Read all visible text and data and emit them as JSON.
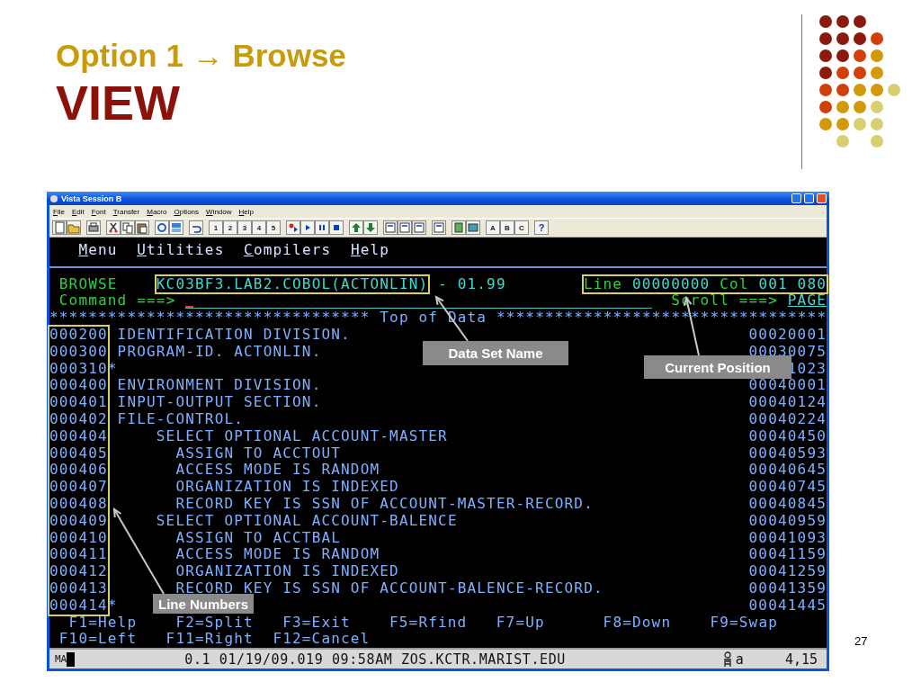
{
  "slide": {
    "title": "Option 1 → Browse",
    "subtitle": "VIEW",
    "page_number": "27"
  },
  "window": {
    "title": "Vista Session B",
    "menu": [
      "File",
      "Edit",
      "Font",
      "Transfer",
      "Macro",
      "Options",
      "Window",
      "Help"
    ],
    "macro_buttons": [
      "1",
      "2",
      "3",
      "4",
      "5"
    ],
    "keypad_buttons": [
      "A",
      "B",
      "C"
    ],
    "help_button": "?"
  },
  "terminal": {
    "action_bar": [
      "Menu",
      "Utilities",
      "Compilers",
      "Help"
    ],
    "header": {
      "mode": "BROWSE",
      "dataset": "KC03BF3.LAB2.COBOL(ACTONLIN)",
      "member_info": "- 01.99",
      "line_label": "Line",
      "line_value": "00000000",
      "col_label": "Col",
      "col_value": "001 080"
    },
    "command": {
      "label": "Command ===>"
    },
    "scroll": {
      "label": "Scroll ===>",
      "value": "PAGE"
    },
    "top_of_data": "********************************* Top of Data **********************************",
    "rows": [
      {
        "number": "000200",
        "text": " IDENTIFICATION DIVISION.",
        "sequence": "00020001"
      },
      {
        "number": "000300",
        "text": " PROGRAM-ID. ACTONLIN.",
        "sequence": "00030075"
      },
      {
        "number": "000310",
        "text": "*",
        "sequence": "1023"
      },
      {
        "number": "000400",
        "text": " ENVIRONMENT DIVISION.",
        "sequence": "00040001"
      },
      {
        "number": "000401",
        "text": " INPUT-OUTPUT SECTION.",
        "sequence": "00040124"
      },
      {
        "number": "000402",
        "text": " FILE-CONTROL.",
        "sequence": "00040224"
      },
      {
        "number": "000404",
        "text": "     SELECT OPTIONAL ACCOUNT-MASTER",
        "sequence": "00040450"
      },
      {
        "number": "000405",
        "text": "       ASSIGN TO ACCTOUT",
        "sequence": "00040593"
      },
      {
        "number": "000406",
        "text": "       ACCESS MODE IS RANDOM",
        "sequence": "00040645"
      },
      {
        "number": "000407",
        "text": "       ORGANIZATION IS INDEXED",
        "sequence": "00040745"
      },
      {
        "number": "000408",
        "text": "       RECORD KEY IS SSN OF ACCOUNT-MASTER-RECORD.",
        "sequence": "00040845"
      },
      {
        "number": "000409",
        "text": "     SELECT OPTIONAL ACCOUNT-BALENCE",
        "sequence": "00040959"
      },
      {
        "number": "000410",
        "text": "       ASSIGN TO ACCTBAL",
        "sequence": "00041093"
      },
      {
        "number": "000411",
        "text": "       ACCESS MODE IS RANDOM",
        "sequence": "00041159"
      },
      {
        "number": "000412",
        "text": "       ORGANIZATION IS INDEXED",
        "sequence": "00041259"
      },
      {
        "number": "000413",
        "text": "       RECORD KEY IS SSN OF ACCOUNT-BALENCE-RECORD.",
        "sequence": "00041359"
      },
      {
        "number": "000414",
        "text": "*",
        "sequence": "00041445"
      }
    ],
    "function_keys": [
      [
        "F1=Help",
        "F2=Split",
        "F3=Exit",
        "F5=Rfind",
        "F7=Up",
        "F8=Down",
        "F9=Swap"
      ],
      [
        "F10=Left",
        "F11=Right",
        "F12=Cancel"
      ]
    ],
    "status_bar": {
      "mode": "MA",
      "info": "0.1 01/19/09.019 09:58AM ZOS.KCTR.MARIST.EDU",
      "input": "a",
      "cursor": "4,15"
    }
  },
  "annotations": [
    {
      "kind": "dataset",
      "label": "Data Set Name"
    },
    {
      "kind": "position",
      "label": "Current Position"
    },
    {
      "kind": "line_numbers",
      "label": "Line Numbers"
    }
  ]
}
